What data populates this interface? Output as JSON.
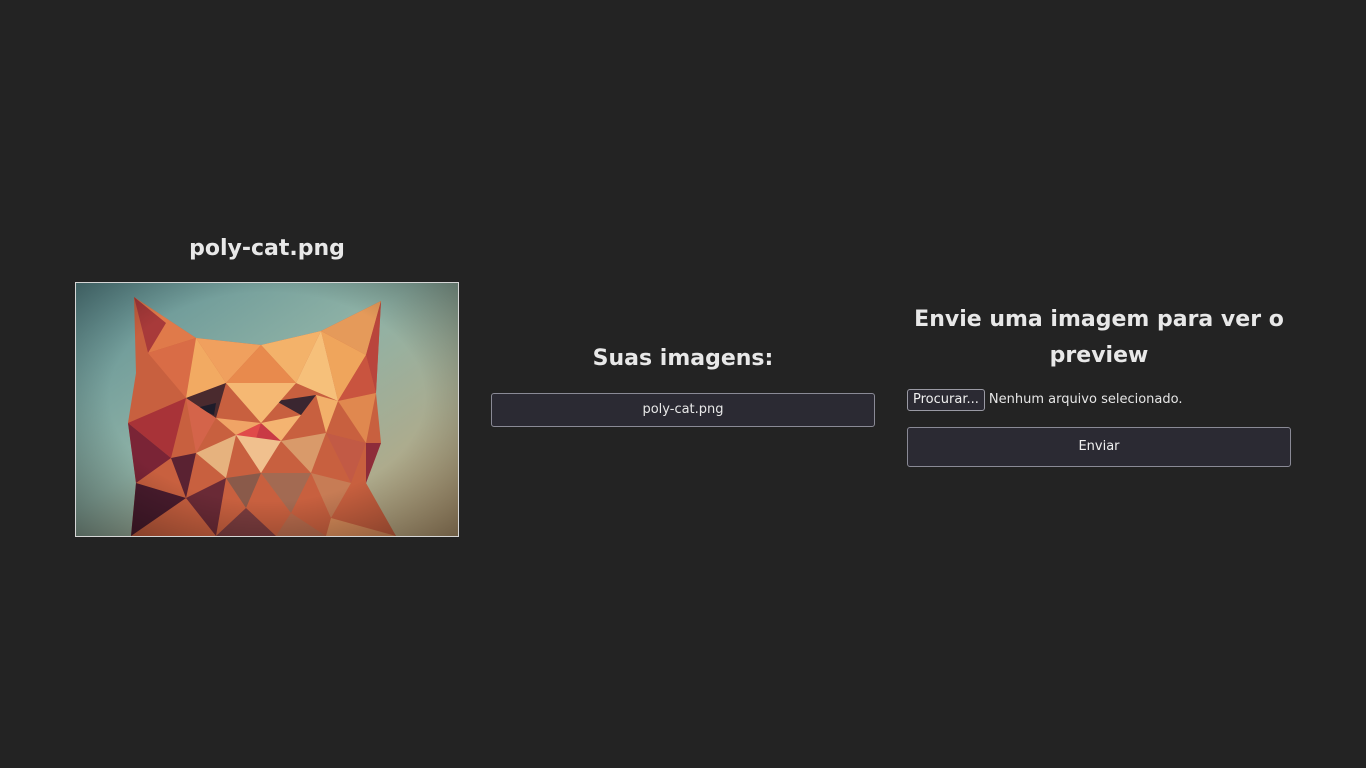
{
  "preview": {
    "title": "poly-cat.png",
    "image_alt": "poly-cat.png"
  },
  "list": {
    "title": "Suas imagens:",
    "items": [
      {
        "label": "poly-cat.png"
      }
    ]
  },
  "upload": {
    "title": "Envie uma imagem para ver o preview",
    "browse_label": "Procurar...",
    "file_status": "Nenhum arquivo selecionado.",
    "send_label": "Enviar"
  },
  "colors": {
    "background": "#232323",
    "button_bg": "#2b2a33",
    "border": "#8a8a96",
    "text": "#e8e8e8"
  }
}
